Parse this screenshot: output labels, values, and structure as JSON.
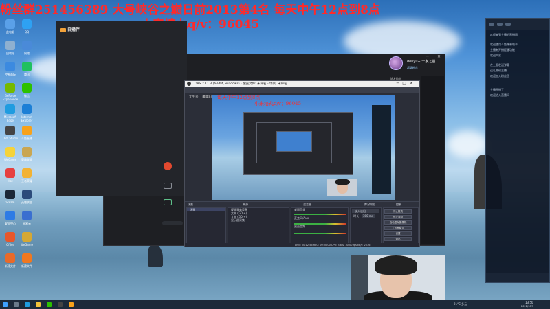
{
  "overlay": {
    "banner_line1": "粉丝群251456389 大号峡谷之巅日前2013第4名 每天中午12点到8点",
    "banner_line2": "小来培丸q/v：96045",
    "inner_line1": "每天中午12点到8点",
    "inner_line2": "小来培丸q/v：96045"
  },
  "desktop_icons": [
    {
      "label": "此电脑",
      "color": "#5aa0e8"
    },
    {
      "label": "QQ",
      "color": "#2ea1f2"
    },
    {
      "label": "回收站",
      "color": "#8fb0d0"
    },
    {
      "label": "网络",
      "color": "#4a8ad8"
    },
    {
      "label": "控制面板",
      "color": "#3c8ae0"
    },
    {
      "label": "腾讯",
      "color": "#20c060"
    },
    {
      "label": "GeForce Experience",
      "color": "#76b900"
    },
    {
      "label": "微信",
      "color": "#2dc100"
    },
    {
      "label": "Microsoft Edge",
      "color": "#1f9ce0"
    },
    {
      "label": "Internet Explorer",
      "color": "#1c7fd6"
    },
    {
      "label": "OBS Studio",
      "color": "#444"
    },
    {
      "label": "斗鱼直播",
      "color": "#f7a21b"
    },
    {
      "label": "WeGame",
      "color": "#f5d33a"
    },
    {
      "label": "英雄联盟",
      "color": "#c9a652"
    },
    {
      "label": "Hot",
      "color": "#e64040"
    },
    {
      "label": "王者荣耀",
      "color": "#f2b233"
    },
    {
      "label": "Steam",
      "color": "#1b2838"
    },
    {
      "label": "英雄联盟",
      "color": "#2c4b7a"
    },
    {
      "label": "安全中心",
      "color": "#2d7be5"
    },
    {
      "label": "网易云",
      "color": "#3a6fd0"
    },
    {
      "label": "Office",
      "color": "#e8572b"
    },
    {
      "label": "WeGame",
      "color": "#d5a834"
    },
    {
      "label": "新建文件",
      "color": "#e86a2a"
    },
    {
      "label": "新建文件",
      "color": "#f07820"
    }
  ],
  "douyu": {
    "username": "douyu+ 一家之猫",
    "badge": "超级粉丝",
    "title_text": "好友动态"
  },
  "obs": {
    "title": "OBS 27.1.3 (64-bit, windows) - 配置文件: 未命名 - 场景: 未命名",
    "menu": [
      "文件(F)",
      "编辑(E)",
      "视图(V)",
      "停靠窗口(D)",
      "配置文件(P)",
      "场景集合(S)",
      "工具(T)",
      "帮助(H)"
    ],
    "dock_headers": [
      "场景",
      "来源",
      "混音器",
      "转场特效",
      "控制"
    ],
    "scenes": [
      "场景"
    ],
    "sources": [
      "视频采集设备",
      "文本 (GDI+)",
      "文本 (GDI+)",
      "显示器采集"
    ],
    "mixer": [
      {
        "name": "桌面音频",
        "db": "0.0 dB"
      },
      {
        "name": "麦克风/Aux",
        "db": "0.0 dB"
      },
      {
        "name": "桌面音频",
        "db": "0.0 dB"
      }
    ],
    "transition": {
      "name": "淡入淡出",
      "duration_label": "时长",
      "duration": "300 ms"
    },
    "controls": [
      "停止推流",
      "停止录制",
      "启动虚拟摄像机",
      "工作室模式",
      "设置",
      "退出"
    ],
    "status": "LIVE: 00:12:56   REC: 00:00:00   CPU: 3.8%, 30.00 fps   kb/s: 2536"
  },
  "chat_panel": {
    "lines": [
      "欢迎来到主播的直播间",
      "",
      "欢迎使用斗鱼弹幕助手",
      "主播有开播提醒功能",
      "欢迎大家",
      "",
      "在上面发送弹幕",
      "送礼物给主播",
      "欢迎加入粉丝团",
      "",
      "",
      "主播开播了",
      "欢迎进入直播间"
    ]
  },
  "taskbar": {
    "weather": "21°C 多云",
    "time": "13:50",
    "date": "2021/10/3"
  },
  "colors": {
    "banner_red": "#ff2a2a",
    "taskbar": "#1c2a3a",
    "obs_dark": "#2b2e38"
  }
}
